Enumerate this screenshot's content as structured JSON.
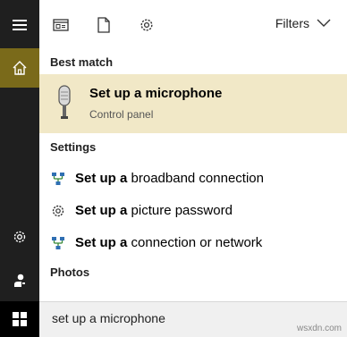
{
  "rail": {
    "menu_icon": "hamburger-icon",
    "home_icon": "home-icon",
    "settings_icon": "gear-icon",
    "user_icon": "user-icon",
    "start_icon": "windows-logo-icon",
    "home_color": "#7a6a1a"
  },
  "toolbar": {
    "icons": [
      "apps-icon",
      "document-icon",
      "gear-icon"
    ],
    "filters_label": "Filters"
  },
  "results": {
    "best_match_header": "Best match",
    "best_match": {
      "title_bold": "Set up a microphone",
      "subtitle": "Control panel",
      "icon": "microphone-icon",
      "highlight_color": "#f1e8c7"
    },
    "settings_header": "Settings",
    "settings": [
      {
        "bold": "Set up a",
        "rest": " broadband connection",
        "icon": "network-icon"
      },
      {
        "bold": "Set up a",
        "rest": " picture password",
        "icon": "gear-icon"
      },
      {
        "bold": "Set up a",
        "rest": " connection or network",
        "icon": "network-icon"
      }
    ],
    "photos_header": "Photos"
  },
  "search": {
    "value": "set up a microphone"
  },
  "watermark": "wsxdn.com"
}
